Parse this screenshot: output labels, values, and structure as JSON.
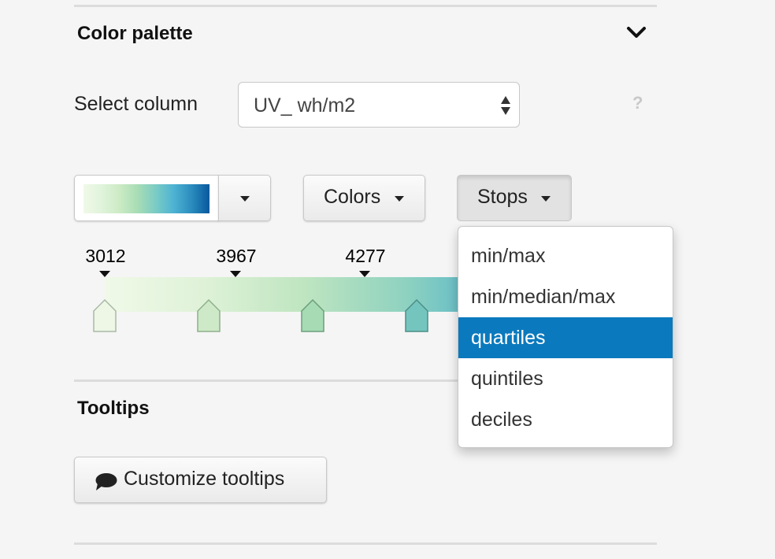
{
  "color_palette": {
    "title": "Color palette",
    "collapse_icon": "chevron-down-icon",
    "select_column": {
      "label": "Select column",
      "value": "UV_ wh/m2",
      "help": "?"
    },
    "palette": {
      "colors": [
        "#f0f9e8",
        "#e0f3db",
        "#ccebc5",
        "#a8ddb5",
        "#7bccc4",
        "#4eb3d3",
        "#2b8cbe",
        "#08589e"
      ]
    },
    "colors_button": "Colors",
    "stops_button": "Stops",
    "stops": {
      "values": [
        "3012",
        "3967",
        "4277"
      ],
      "handle_colors": [
        "#eef7e6",
        "#cde9c7",
        "#a6dbb4",
        "#74c5bd"
      ]
    },
    "stops_menu": {
      "items": [
        "min/max",
        "min/median/max",
        "quartiles",
        "quintiles",
        "deciles"
      ],
      "selected": "quartiles"
    }
  },
  "tooltips": {
    "title": "Tooltips",
    "customize_button": "Customize tooltips",
    "icon": "comment-icon"
  },
  "colors": {
    "selected_item_bg": "#0b79bd",
    "page_bg": "#f5f5f5"
  }
}
